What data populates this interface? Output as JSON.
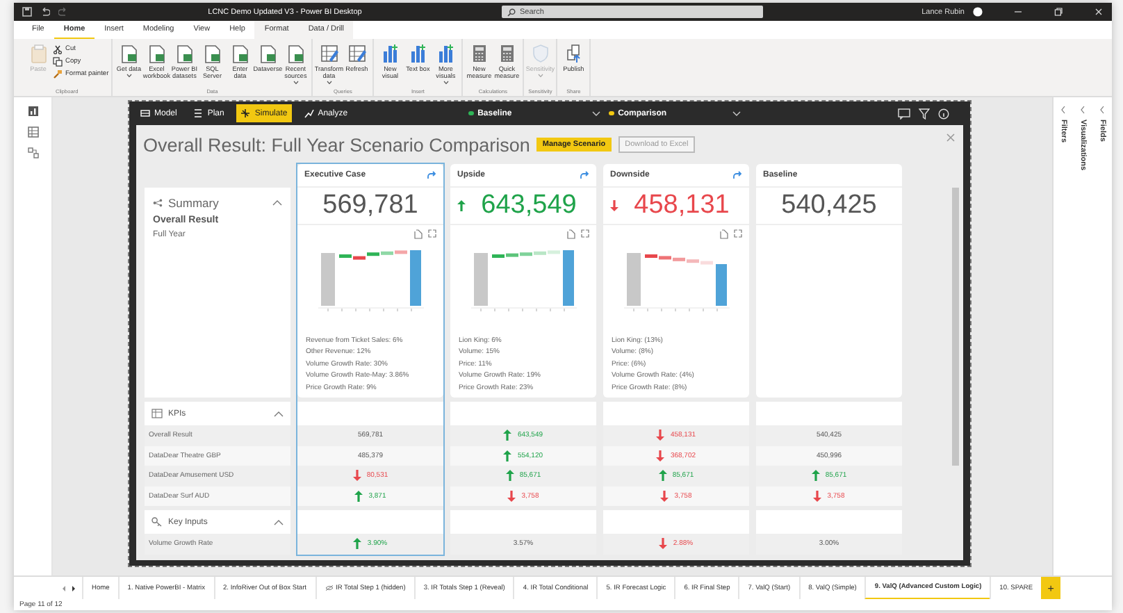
{
  "window": {
    "title": "LCNC Demo Updated V3 - Power BI Desktop",
    "search_placeholder": "Search",
    "user": "Lance Rubin"
  },
  "ribbon_tabs": [
    {
      "label": "File",
      "selected": false,
      "contextual": false
    },
    {
      "label": "Home",
      "selected": true,
      "contextual": false
    },
    {
      "label": "Insert",
      "selected": false,
      "contextual": false
    },
    {
      "label": "Modeling",
      "selected": false,
      "contextual": false
    },
    {
      "label": "View",
      "selected": false,
      "contextual": false
    },
    {
      "label": "Help",
      "selected": false,
      "contextual": false
    },
    {
      "label": "Format",
      "selected": false,
      "contextual": true
    },
    {
      "label": "Data / Drill",
      "selected": false,
      "contextual": true
    }
  ],
  "ribbon_groups": [
    {
      "label": "Clipboard",
      "buttons": [
        {
          "label": "Paste",
          "kind": "large",
          "disabled": true,
          "dropdown": false
        },
        {
          "label": "Cut",
          "kind": "small",
          "disabled": false,
          "dropdown": false
        },
        {
          "label": "Copy",
          "kind": "small",
          "disabled": false,
          "dropdown": false
        },
        {
          "label": "Format painter",
          "kind": "small",
          "disabled": false,
          "dropdown": false
        }
      ]
    },
    {
      "label": "Data",
      "buttons": [
        {
          "label": "Get data",
          "kind": "large",
          "disabled": false,
          "dropdown": true
        },
        {
          "label": "Excel workbook",
          "kind": "large",
          "disabled": false,
          "dropdown": false
        },
        {
          "label": "Power BI datasets",
          "kind": "large",
          "disabled": false,
          "dropdown": false
        },
        {
          "label": "SQL Server",
          "kind": "large",
          "disabled": false,
          "dropdown": false
        },
        {
          "label": "Enter data",
          "kind": "large",
          "disabled": false,
          "dropdown": false
        },
        {
          "label": "Dataverse",
          "kind": "large",
          "disabled": false,
          "dropdown": false
        },
        {
          "label": "Recent sources",
          "kind": "large",
          "disabled": false,
          "dropdown": true
        }
      ]
    },
    {
      "label": "Queries",
      "buttons": [
        {
          "label": "Transform data",
          "kind": "large",
          "disabled": false,
          "dropdown": true
        },
        {
          "label": "Refresh",
          "kind": "large",
          "disabled": false,
          "dropdown": false
        }
      ]
    },
    {
      "label": "Insert",
      "buttons": [
        {
          "label": "New visual",
          "kind": "large",
          "disabled": false,
          "dropdown": false
        },
        {
          "label": "Text box",
          "kind": "large",
          "disabled": false,
          "dropdown": false
        },
        {
          "label": "More visuals",
          "kind": "large",
          "disabled": false,
          "dropdown": true
        }
      ]
    },
    {
      "label": "Calculations",
      "buttons": [
        {
          "label": "New measure",
          "kind": "large",
          "disabled": false,
          "dropdown": false
        },
        {
          "label": "Quick measure",
          "kind": "large",
          "disabled": false,
          "dropdown": false
        }
      ]
    },
    {
      "label": "Sensitivity",
      "buttons": [
        {
          "label": "Sensitivity",
          "kind": "large",
          "disabled": true,
          "dropdown": true
        }
      ]
    },
    {
      "label": "Share",
      "buttons": [
        {
          "label": "Publish",
          "kind": "large",
          "disabled": false,
          "dropdown": false
        }
      ]
    }
  ],
  "side_panes": [
    {
      "label": "Filters"
    },
    {
      "label": "Visualizations"
    },
    {
      "label": "Fields"
    }
  ],
  "report": {
    "nav": [
      {
        "label": "Model",
        "selected": false
      },
      {
        "label": "Plan",
        "selected": false
      },
      {
        "label": "Simulate",
        "selected": true
      },
      {
        "label": "Analyze",
        "selected": false
      }
    ],
    "selectors": [
      {
        "label": "Baseline",
        "color": "#2fb457"
      },
      {
        "label": "Comparison",
        "color": "#f2c811"
      }
    ],
    "title": "Overall Result: Full Year Scenario Comparison",
    "buttons": [
      {
        "label": "Manage Scenario",
        "disabled": false
      },
      {
        "label": "Download to Excel",
        "disabled": true
      }
    ]
  },
  "summary": {
    "title": "Summary",
    "expanded": true,
    "heading": "Overall Result",
    "subheading": "Full Year"
  },
  "scenarios": [
    {
      "name": "Executive Case",
      "value": "569,781",
      "positive": false,
      "negative": false,
      "selected": true,
      "apply_icon": true,
      "chart": true,
      "drivers": [
        "Revenue from Ticket Sales: 6%",
        "Other Revenue: 12%",
        "Volume Growth Rate: 30%",
        "Volume Growth Rate-May: 3.86%",
        "Price Growth Rate: 9%"
      ]
    },
    {
      "name": "Upside",
      "value": "643,549",
      "positive": true,
      "negative": false,
      "selected": false,
      "apply_icon": true,
      "chart": true,
      "drivers": [
        "Lion King: 6%",
        "Volume: 15%",
        "Price: 11%",
        "Volume Growth Rate: 19%",
        "Price Growth Rate: 23%"
      ]
    },
    {
      "name": "Downside",
      "value": "458,131",
      "positive": false,
      "negative": true,
      "selected": false,
      "apply_icon": true,
      "chart": true,
      "drivers": [
        "Lion King: (13%)",
        "Volume: (8%)",
        "Price: (6%)",
        "Volume Growth Rate: (4%)",
        "Price Growth Rate: (8%)"
      ]
    },
    {
      "name": "Baseline",
      "value": "540,425",
      "positive": false,
      "negative": false,
      "selected": false,
      "apply_icon": false,
      "chart": false
    }
  ],
  "kpis": {
    "title": "KPIs",
    "expanded": true,
    "rows": [
      {
        "label": "Overall Result",
        "values": [
          {
            "text": "569,781",
            "positive": false,
            "negative": false
          },
          {
            "text": "643,549",
            "positive": true,
            "negative": false
          },
          {
            "text": "458,131",
            "positive": false,
            "negative": true
          },
          {
            "text": "540,425",
            "positive": false,
            "negative": false
          }
        ]
      },
      {
        "label": "DataDear Theatre GBP",
        "values": [
          {
            "text": "485,379",
            "positive": false,
            "negative": false
          },
          {
            "text": "554,120",
            "positive": true,
            "negative": false
          },
          {
            "text": "368,702",
            "positive": false,
            "negative": true
          },
          {
            "text": "450,996",
            "positive": false,
            "negative": false
          }
        ]
      },
      {
        "label": "DataDear Amusement USD",
        "values": [
          {
            "text": "80,531",
            "positive": false,
            "negative": true
          },
          {
            "text": "85,671",
            "positive": true,
            "negative": false
          },
          {
            "text": "85,671",
            "positive": true,
            "negative": false
          },
          {
            "text": "85,671",
            "positive": true,
            "negative": false
          }
        ]
      },
      {
        "label": "DataDear Surf AUD",
        "values": [
          {
            "text": "3,871",
            "positive": true,
            "negative": false
          },
          {
            "text": "3,758",
            "positive": false,
            "negative": true
          },
          {
            "text": "3,758",
            "positive": false,
            "negative": true
          },
          {
            "text": "3,758",
            "positive": false,
            "negative": true
          }
        ]
      }
    ]
  },
  "key_inputs": {
    "title": "Key Inputs",
    "expanded": true,
    "rows": [
      {
        "label": "Volume Growth Rate",
        "values": [
          {
            "text": "3.90%",
            "positive": true,
            "negative": false
          },
          {
            "text": "3.57%",
            "positive": false,
            "negative": false
          },
          {
            "text": "2.88%",
            "positive": false,
            "negative": true
          },
          {
            "text": "3.00%",
            "positive": false,
            "negative": false
          }
        ]
      }
    ]
  },
  "page_tabs": [
    {
      "label": "Home",
      "selected": false,
      "hidden": false
    },
    {
      "label": "1. Native PowerBI - Matrix",
      "selected": false,
      "hidden": false
    },
    {
      "label": "2. InfoRiver Out of Box Start",
      "selected": false,
      "hidden": false
    },
    {
      "label": "IR Total Step 1 (hidden)",
      "selected": false,
      "hidden": true
    },
    {
      "label": "3. IR Totals Step 1 (Reveal)",
      "selected": false,
      "hidden": false
    },
    {
      "label": "4. IR Total Conditional",
      "selected": false,
      "hidden": false
    },
    {
      "label": "5. IR Forecast Logic",
      "selected": false,
      "hidden": false
    },
    {
      "label": "6. IR Final Step",
      "selected": false,
      "hidden": false
    },
    {
      "label": "7. ValQ (Start)",
      "selected": false,
      "hidden": false
    },
    {
      "label": "8. ValQ (Simple)",
      "selected": false,
      "hidden": false
    },
    {
      "label": "9. ValQ (Advanced Custom Logic)",
      "selected": true,
      "hidden": false
    },
    {
      "label": "10. SPARE",
      "selected": false,
      "hidden": false
    }
  ],
  "add_page": "+",
  "status_bar": "Page 11 of 12"
}
